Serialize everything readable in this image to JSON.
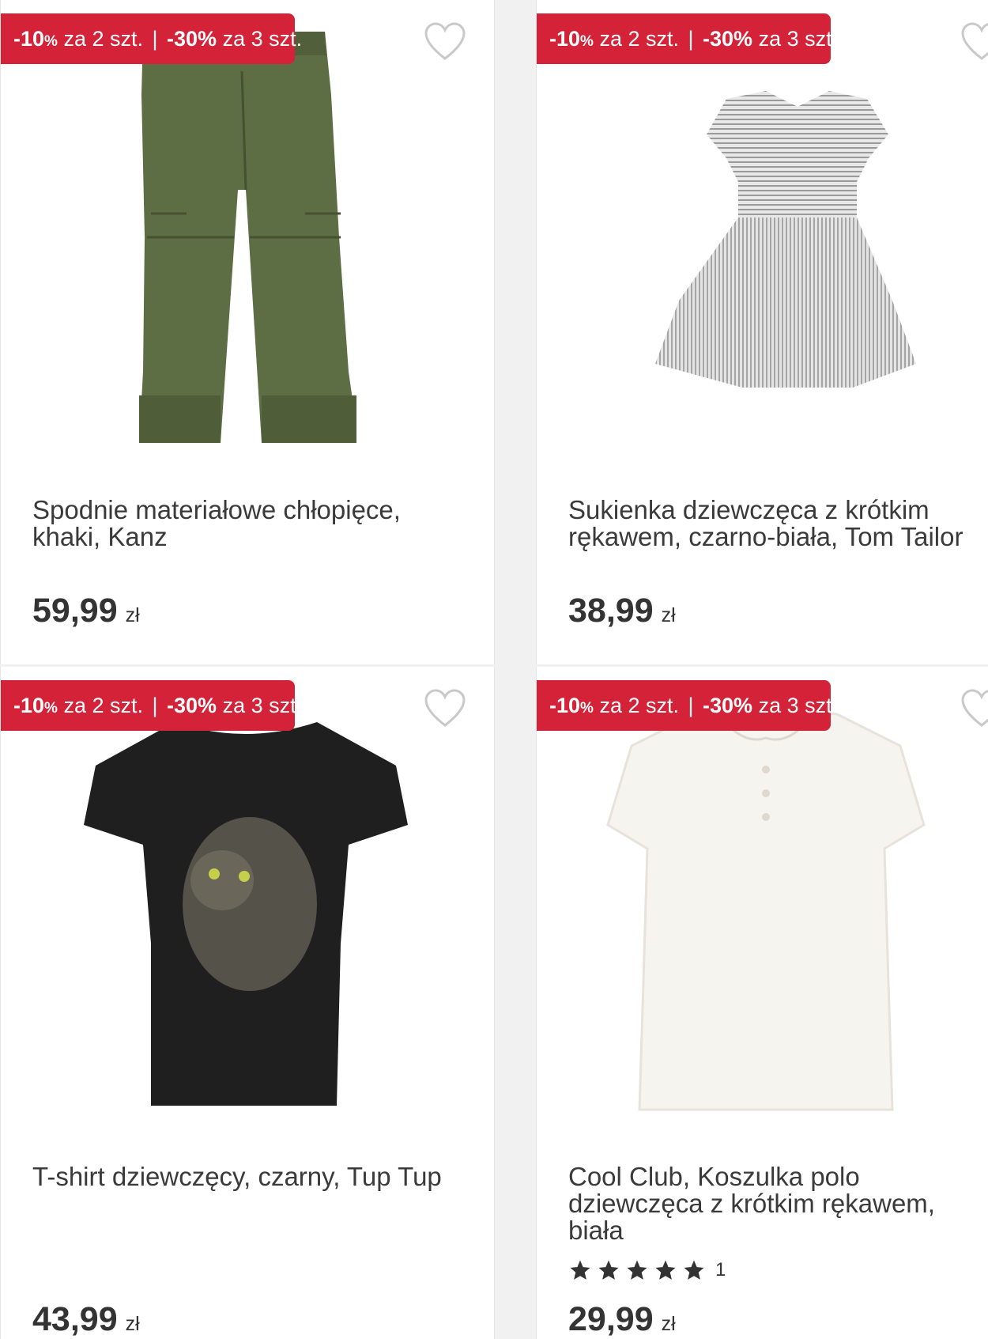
{
  "promo_badge": {
    "part1_value": "-10",
    "part1_pct": "%",
    "part1_text": " za 2 szt.",
    "separator": "|",
    "part2_value": "-30%",
    "part2_text": " za 3 szt."
  },
  "products": [
    {
      "title": "Spodnie materiałowe chłopięce, khaki, Kanz",
      "price": "59,99",
      "currency": "zł"
    },
    {
      "title": "Sukienka dziewczęca z krótkim rękawem, czarno-biała, Tom Tailor",
      "price": "38,99",
      "currency": "zł"
    },
    {
      "title": "T-shirt dziewczęcy, czarny, Tup Tup",
      "price": "43,99",
      "currency": "zł"
    },
    {
      "title": "Cool Club, Koszulka polo dziewczęca z krótkim rękawem, biała",
      "price": "29,99",
      "currency": "zł",
      "rating_stars": 5,
      "rating_count": "1"
    }
  ],
  "colors": {
    "badge": "#d42238",
    "text": "#333333",
    "star": "#333333"
  },
  "icons": {
    "favorite": "heart-outline-icon",
    "rating": "star-icon"
  }
}
